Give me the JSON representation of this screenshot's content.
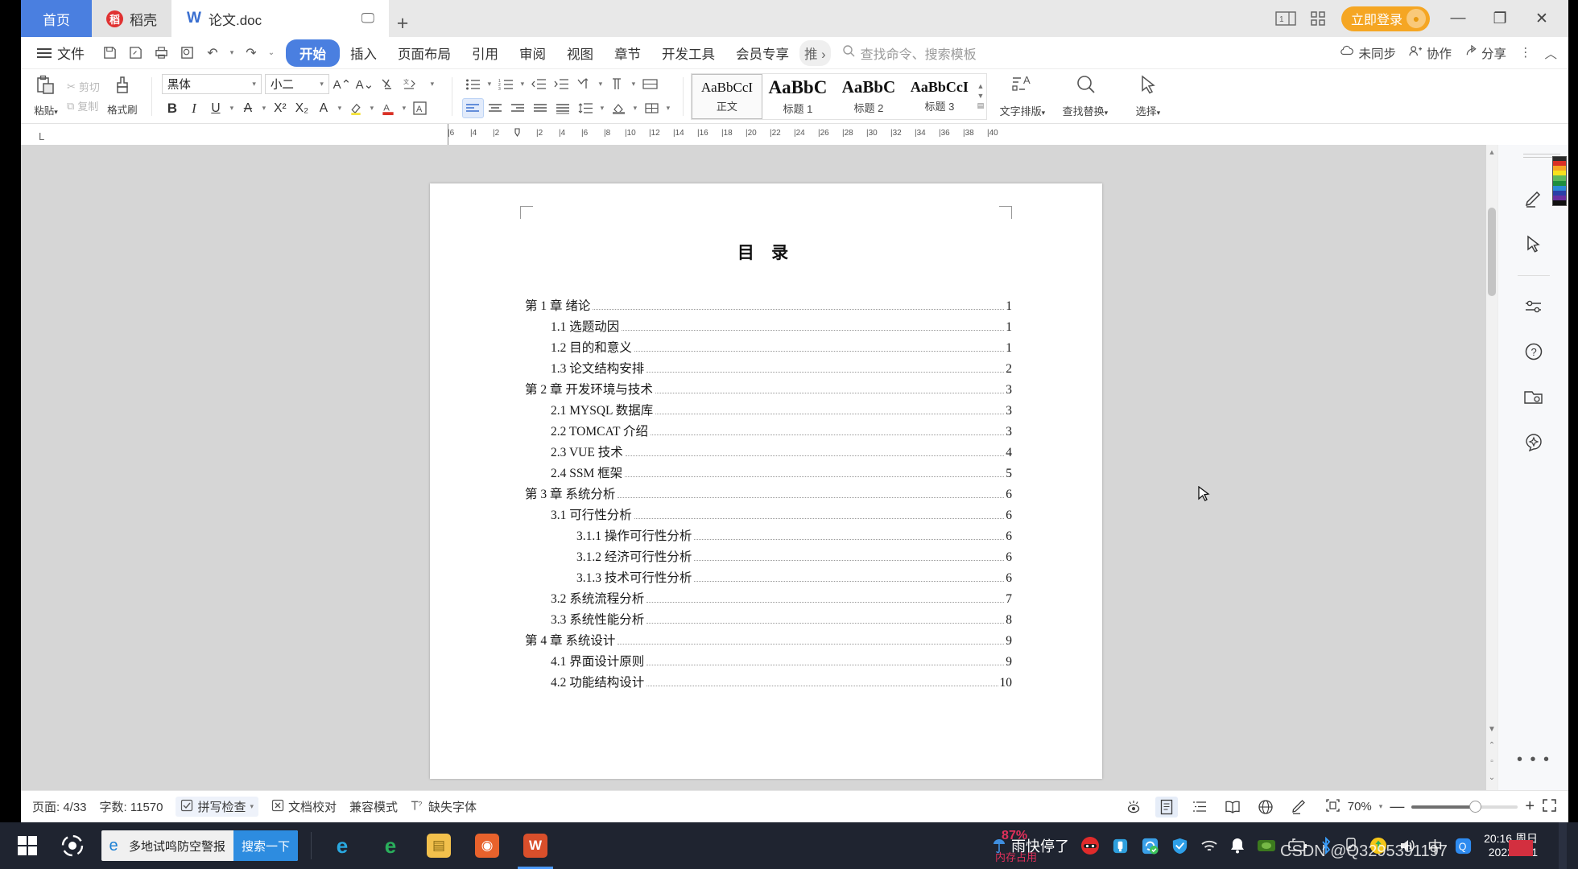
{
  "window": {
    "tabs": [
      {
        "label": "首页",
        "icon": "home-icon",
        "state": "home"
      },
      {
        "label": "稻壳",
        "icon": "docer-icon",
        "state": "normal"
      },
      {
        "label": "论文.doc",
        "icon": "word-doc-icon",
        "state": "active"
      }
    ],
    "tab_actions": {
      "screen_icon": "monitor-icon",
      "new_tab": "+"
    },
    "right_controls": {
      "page_view_icon": "page-view-icon",
      "grid_icon": "grid-apps-icon",
      "login_label": "立即登录",
      "minimize": "—",
      "maximize": "❐",
      "close": "✕"
    }
  },
  "menubar": {
    "file_label": "文件",
    "quick_access": [
      "save-icon",
      "save-as-icon",
      "print-icon",
      "print-preview-icon",
      "undo-icon",
      "redo-icon",
      "customize-qat-icon"
    ],
    "tabs": [
      {
        "label": "开始",
        "selected": true
      },
      {
        "label": "插入",
        "selected": false
      },
      {
        "label": "页面布局",
        "selected": false
      },
      {
        "label": "引用",
        "selected": false
      },
      {
        "label": "审阅",
        "selected": false
      },
      {
        "label": "视图",
        "selected": false
      },
      {
        "label": "章节",
        "selected": false
      },
      {
        "label": "开发工具",
        "selected": false
      },
      {
        "label": "会员专享",
        "selected": false
      },
      {
        "label": "推",
        "selected": false
      }
    ],
    "more_arrow": "›",
    "search_placeholder": "查找命令、搜索模板",
    "right": [
      {
        "label": "未同步",
        "icon": "cloud-sync-icon"
      },
      {
        "label": "协作",
        "icon": "collaborate-icon"
      },
      {
        "label": "分享",
        "icon": "share-icon"
      }
    ],
    "overflow": "⋮",
    "collapse": "︿"
  },
  "ribbon": {
    "clipboard": {
      "paste_label": "粘贴",
      "paste_icon": "paste-icon",
      "cut_label": "剪切",
      "cut_icon": "scissors-icon",
      "copy_label": "复制",
      "copy_icon": "copy-icon",
      "format_painter_label": "格式刷",
      "format_painter_icon": "format-painter-icon"
    },
    "font": {
      "family_value": "黑体",
      "size_value": "小二",
      "grow_icon": "A+",
      "shrink_icon": "A-",
      "clear_format_icon": "clear-format-icon",
      "pinyin_icon": "pinyin-guide-icon",
      "bold": "B",
      "italic": "I",
      "underline": "U",
      "strikethrough": "A",
      "superscript": "X²",
      "subscript": "X₂",
      "char_border_icon": "char-border-icon",
      "highlight_icon": "highlight-color-icon",
      "font_color_icon": "font-color-icon",
      "text_effect_icon": "text-effect-icon"
    },
    "paragraph": {
      "bullets_icon": "bullet-list-icon",
      "numbering_icon": "numbered-list-icon",
      "decrease_indent_icon": "decrease-indent-icon",
      "increase_indent_icon": "increase-indent-icon",
      "sort_icon": "sort-icon",
      "show_marks_icon": "show-formatting-marks-icon",
      "align_left_icon": "align-left-icon",
      "align_center_icon": "align-center-icon",
      "align_right_icon": "align-right-icon",
      "justify_icon": "justify-icon",
      "distribute_icon": "distribute-icon",
      "line_spacing_icon": "line-spacing-icon",
      "shading_icon": "shading-icon",
      "borders_icon": "borders-icon"
    },
    "styles": [
      {
        "preview": "AaBbCcI",
        "name": "正文",
        "selected": true,
        "size": 17,
        "weight": "normal"
      },
      {
        "preview": "AaBbC",
        "name": "标题 1",
        "selected": false,
        "size": 23,
        "weight": "bold"
      },
      {
        "preview": "AaBbC",
        "name": "标题 2",
        "selected": false,
        "size": 21,
        "weight": "bold"
      },
      {
        "preview": "AaBbCcI",
        "name": "标题 3",
        "selected": false,
        "size": 18,
        "weight": "bold"
      }
    ],
    "tools": [
      {
        "label": "文字排版",
        "icon": "text-layout-icon",
        "caret": true
      },
      {
        "label": "查找替换",
        "icon": "find-replace-icon",
        "caret": true
      },
      {
        "label": "选择",
        "icon": "select-cursor-icon",
        "caret": true
      }
    ]
  },
  "ruler": {
    "marks": [
      "6",
      "4",
      "2",
      "2",
      "4",
      "6",
      "8",
      "10",
      "12",
      "14",
      "16",
      "18",
      "20",
      "22",
      "24",
      "26",
      "28",
      "30",
      "32",
      "34",
      "36",
      "38",
      "40"
    ],
    "corner_label": "L"
  },
  "document": {
    "title": "目  录",
    "toc": [
      {
        "level": 1,
        "text": "第 1 章 绪论",
        "page": "1"
      },
      {
        "level": 2,
        "text": "1.1 选题动因",
        "page": "1"
      },
      {
        "level": 2,
        "text": "1.2 目的和意义",
        "page": "1"
      },
      {
        "level": 2,
        "text": "1.3 论文结构安排",
        "page": "2"
      },
      {
        "level": 1,
        "text": "第 2 章 开发环境与技术",
        "page": "3"
      },
      {
        "level": 2,
        "text": "2.1 MYSQL 数据库",
        "page": "3"
      },
      {
        "level": 2,
        "text": "2.2 TOMCAT 介绍",
        "page": "3"
      },
      {
        "level": 2,
        "text": "2.3 VUE 技术",
        "page": "4"
      },
      {
        "level": 2,
        "text": "2.4 SSM 框架",
        "page": "5"
      },
      {
        "level": 1,
        "text": "第 3 章 系统分析",
        "page": "6"
      },
      {
        "level": 2,
        "text": "3.1 可行性分析",
        "page": "6"
      },
      {
        "level": 3,
        "text": "3.1.1 操作可行性分析",
        "page": "6"
      },
      {
        "level": 3,
        "text": "3.1.2 经济可行性分析",
        "page": "6"
      },
      {
        "level": 3,
        "text": "3.1.3 技术可行性分析",
        "page": "6"
      },
      {
        "level": 2,
        "text": "3.2 系统流程分析",
        "page": "7"
      },
      {
        "level": 2,
        "text": "3.3 系统性能分析",
        "page": "8"
      },
      {
        "level": 1,
        "text": "第 4 章 系统设计",
        "page": "9"
      },
      {
        "level": 2,
        "text": "4.1 界面设计原则",
        "page": "9"
      },
      {
        "level": 2,
        "text": "4.2 功能结构设计",
        "page": "10"
      }
    ]
  },
  "right_rail": {
    "icons": [
      {
        "name": "pen-highlight-icon"
      },
      {
        "name": "cursor-select-icon"
      },
      {
        "name": "settings-sliders-icon"
      },
      {
        "name": "help-question-icon"
      },
      {
        "name": "ocr-scan-icon"
      },
      {
        "name": "ai-spark-icon"
      }
    ],
    "more": "• • •"
  },
  "statusbar": {
    "page_label": "页面: 4/33",
    "word_count_label": "字数: 11570",
    "spellcheck_label": "拼写检查",
    "spellcheck_icon": "spellcheck-icon",
    "proofread_label": "文档校对",
    "proofread_icon": "proofread-icon",
    "compat_label": "兼容模式",
    "missing_font_label": "缺失字体",
    "missing_font_icon": "missing-font-icon",
    "view_icons": [
      {
        "name": "eye-protect-icon",
        "active": false
      },
      {
        "name": "page-view-icon",
        "active": true
      },
      {
        "name": "outline-view-icon",
        "active": false
      },
      {
        "name": "reading-view-icon",
        "active": false
      },
      {
        "name": "web-view-icon",
        "active": false
      },
      {
        "name": "annotate-icon",
        "active": false
      }
    ],
    "fit_icon": "fit-page-icon",
    "zoom_value": "70%",
    "zoom_out": "—",
    "zoom_in": "+",
    "fullscreen_icon": "fullscreen-icon"
  },
  "taskbar": {
    "start_icon": "windows-start-icon",
    "cortana_icon": "cortana-icon",
    "search": {
      "engine_icon": "ie-browser-icon",
      "text": "多地试鸣防空警报",
      "button_label": "搜索一下"
    },
    "apps": [
      {
        "name": "edge-icon",
        "label": "e",
        "color": "#1a7fd4",
        "active": false
      },
      {
        "name": "browser-360-icon",
        "label": "e",
        "color": "#2aaf5c",
        "active": false
      },
      {
        "name": "folder-explorer-icon",
        "label": "▤",
        "color": "#f2c04c",
        "active": false
      },
      {
        "name": "firefox-icon",
        "label": "◉",
        "color": "#e8622c",
        "active": false
      },
      {
        "name": "wps-writer-icon",
        "label": "W",
        "color": "#d94f2b",
        "active": true
      }
    ],
    "weather": {
      "text": "雨快停了",
      "icon": "umbrella-icon",
      "memory_percent": "87%",
      "memory_label": "内存占用"
    },
    "tray_icons": [
      {
        "name": "security-ninja-icon"
      },
      {
        "name": "usb-drive-icon"
      },
      {
        "name": "sync-check-icon"
      },
      {
        "name": "tencent-shield-icon"
      },
      {
        "name": "wifi-icon"
      },
      {
        "name": "notification-bell-icon"
      },
      {
        "name": "nvidia-icon"
      },
      {
        "name": "battery-icon"
      },
      {
        "name": "bluetooth-icon"
      },
      {
        "name": "eject-usb-icon"
      },
      {
        "name": "wechat-pay-icon"
      },
      {
        "name": "volume-icon"
      },
      {
        "name": "ime-chinese-icon"
      },
      {
        "name": "qq-icon"
      }
    ],
    "clock": {
      "time": "20:16 周日",
      "date": "2022/9/11"
    },
    "watermark": "CSDN @Q3295391197",
    "show_desktop": "show-desktop-button"
  }
}
